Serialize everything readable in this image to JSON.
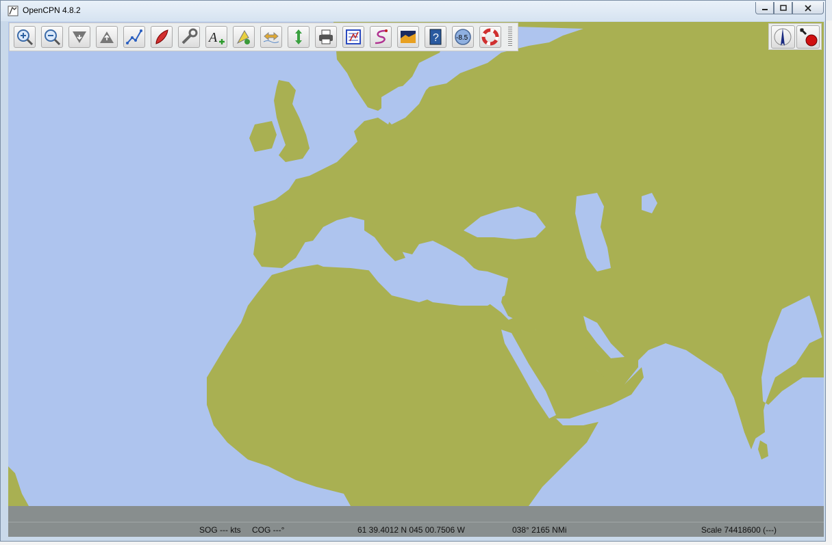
{
  "window": {
    "title": "OpenCPN 4.8.2"
  },
  "toolbar": {
    "tools": [
      {
        "name": "zoom-in-icon"
      },
      {
        "name": "zoom-out-icon"
      },
      {
        "name": "scale-down-icon"
      },
      {
        "name": "scale-up-icon"
      },
      {
        "name": "route-icon"
      },
      {
        "name": "auto-follow-icon"
      },
      {
        "name": "settings-icon"
      },
      {
        "name": "text-icon"
      },
      {
        "name": "current-icon"
      },
      {
        "name": "tide-icon"
      },
      {
        "name": "current-arrows-icon"
      },
      {
        "name": "print-icon"
      },
      {
        "name": "route-manager-icon"
      },
      {
        "name": "track-icon"
      },
      {
        "name": "color-scheme-icon"
      },
      {
        "name": "help-icon"
      },
      {
        "name": "ais-icon"
      },
      {
        "name": "mob-icon"
      }
    ],
    "tide_value": "-8.5"
  },
  "status": {
    "sog": "SOG --- kts",
    "cog": "COG ---°",
    "position": "61 39.4012 N   045 00.7506 W",
    "bearing": "038°  2165 NMi",
    "scale": "Scale 74418600 (---)"
  },
  "colors": {
    "land": "#a9b052",
    "sea": "#aec4ee",
    "statusbar": "#888e8e"
  }
}
